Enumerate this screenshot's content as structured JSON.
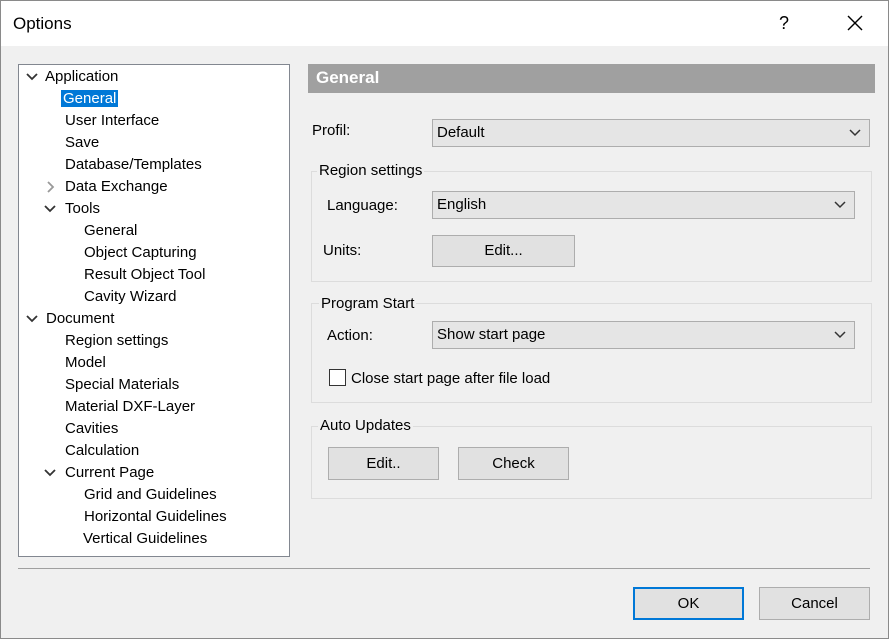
{
  "window": {
    "title": "Options",
    "help": "?"
  },
  "tree": {
    "items": [
      {
        "label": "Application",
        "expander": "expanded"
      },
      {
        "label": "General",
        "selected": true
      },
      {
        "label": "User Interface"
      },
      {
        "label": "Save"
      },
      {
        "label": "Database/Templates"
      },
      {
        "label": "Data Exchange",
        "expander": "collapsed"
      },
      {
        "label": "Tools",
        "expander": "expanded"
      },
      {
        "label": "General"
      },
      {
        "label": "Object Capturing"
      },
      {
        "label": "Result Object Tool"
      },
      {
        "label": "Cavity Wizard"
      },
      {
        "label": "Document",
        "expander": "expanded"
      },
      {
        "label": "Region settings"
      },
      {
        "label": "Model"
      },
      {
        "label": "Special Materials"
      },
      {
        "label": "Material DXF-Layer"
      },
      {
        "label": "Cavities"
      },
      {
        "label": "Calculation"
      },
      {
        "label": "Current Page",
        "expander": "expanded"
      },
      {
        "label": "Grid and Guidelines"
      },
      {
        "label": "Horizontal Guidelines"
      },
      {
        "label": "Vertical Guidelines"
      }
    ]
  },
  "panel": {
    "header": "General",
    "profil": {
      "label": "Profil:",
      "value": "Default"
    },
    "region": {
      "title": "Region settings",
      "language_label": "Language:",
      "language_value": "English",
      "units_label": "Units:",
      "units_button": "Edit..."
    },
    "program_start": {
      "title": "Program Start",
      "action_label": "Action:",
      "action_value": "Show start page",
      "checkbox_label": "Close start page after file load",
      "checkbox_checked": false
    },
    "auto_updates": {
      "title": "Auto Updates",
      "edit_button": "Edit..",
      "check_button": "Check"
    }
  },
  "footer": {
    "ok": "OK",
    "cancel": "Cancel"
  },
  "colors": {
    "selection": "#0078d7",
    "header_bg": "#a0a0a0",
    "default_border": "#0078d7"
  }
}
